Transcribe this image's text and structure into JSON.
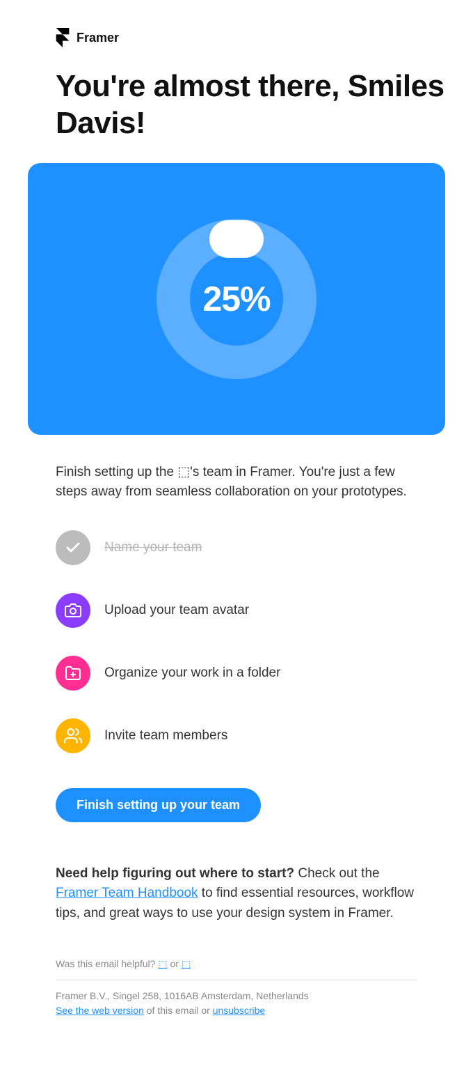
{
  "brand": "Framer",
  "headline": "You're almost there, Smiles Davis!",
  "progress": {
    "percent_label": "25%"
  },
  "intro": "Finish setting up the ⬚'s team in Framer. You're just a few steps away from seamless collaboration on your prototypes.",
  "steps": {
    "done": "Name your team",
    "upload": "Upload your team avatar",
    "folder": "Organize your work in a folder",
    "invite": "Invite team members"
  },
  "cta": "Finish setting up your team",
  "help": {
    "strong": "Need help figuring out where to start?",
    "pre_link": " Check out the ",
    "link": "Framer Team Handbook",
    "post_link": " to find essential resources, workflow tips, and great ways to use your design system in Framer."
  },
  "feedback": {
    "text": "Was this email helpful? ",
    "yes": "⬚",
    "sep": " or ",
    "no": "⬚"
  },
  "footer": {
    "address": "Framer B.V., Singel 258, 1016AB Amsterdam, Netherlands",
    "web_link": "See the web version",
    "mid": " of this email or ",
    "unsub": "unsubscribe"
  }
}
